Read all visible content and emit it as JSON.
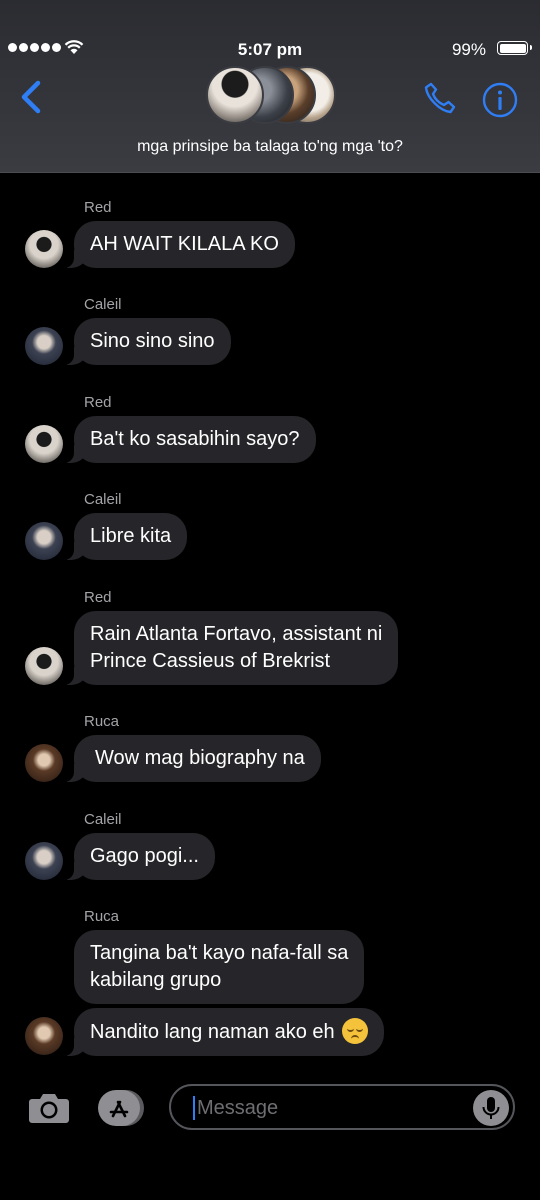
{
  "status_bar": {
    "time": "5:07 pm",
    "battery": "99%"
  },
  "header": {
    "title": "mga prinsipe ba talaga to'ng mga 'to?"
  },
  "colors": {
    "accent": "#2f7ef5",
    "bubble": "#26262a",
    "sender": "#a4a4a8"
  },
  "messages": [
    {
      "sender": "Red",
      "avatar": "red",
      "lines": [
        "AH WAIT KILALA KO"
      ]
    },
    {
      "sender": "Caleil",
      "avatar": "caleil",
      "lines": [
        "Sino sino sino"
      ]
    },
    {
      "sender": "Red",
      "avatar": "red",
      "lines": [
        "Ba't ko sasabihin sayo?"
      ]
    },
    {
      "sender": "Caleil",
      "avatar": "caleil",
      "lines": [
        "Libre kita"
      ]
    },
    {
      "sender": "Red",
      "avatar": "red",
      "lines": [
        "Rain Atlanta Fortavo, assistant ni",
        "Prince Cassieus of Brekrist"
      ]
    },
    {
      "sender": "Ruca",
      "avatar": "ruca",
      "lines": [
        "Wow mag biography na"
      ]
    },
    {
      "sender": "Caleil",
      "avatar": "caleil",
      "lines": [
        "Gago pogi..."
      ]
    },
    {
      "sender": "Ruca",
      "avatar": "ruca",
      "lines": [
        "Tangina ba't kayo nafa-fall sa",
        "kabilang grupo"
      ]
    },
    {
      "sender": "",
      "avatar": "ruca",
      "lines": [
        "Nandito lang naman ako eh"
      ],
      "emoji": "pensive-face"
    }
  ],
  "composer": {
    "placeholder": "Message"
  }
}
